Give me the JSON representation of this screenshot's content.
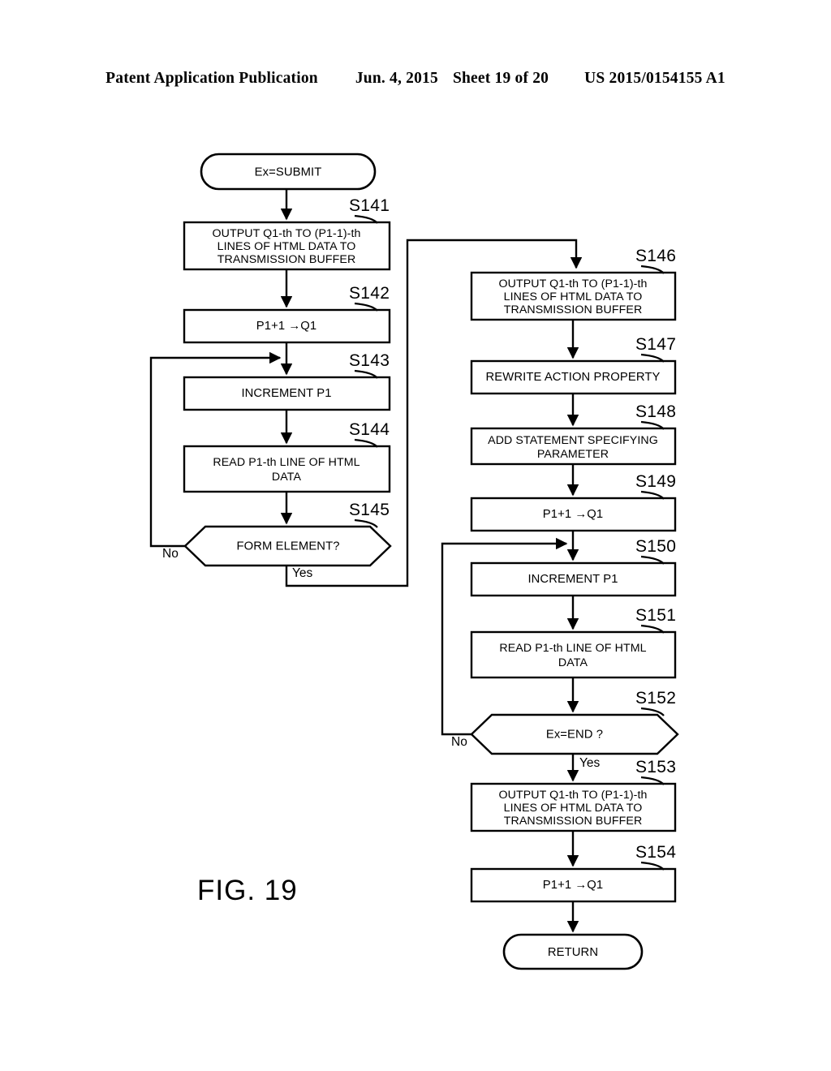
{
  "header": {
    "publication": "Patent Application Publication",
    "date": "Jun. 4, 2015",
    "sheet": "Sheet 19 of 20",
    "number": "US 2015/0154155 A1"
  },
  "figure": {
    "caption": "FIG. 19"
  },
  "flowchart": {
    "start": {
      "id": "start-terminal",
      "text": "Ex=SUBMIT"
    },
    "end": {
      "id": "return-terminal",
      "text": "RETURN"
    },
    "steps": [
      {
        "id": "S141",
        "label": "S141",
        "shape": "process",
        "lines": [
          "OUTPUT Q1-th TO (P1-1)-th",
          "LINES OF HTML DATA TO",
          "TRANSMISSION BUFFER"
        ]
      },
      {
        "id": "S142",
        "label": "S142",
        "shape": "process",
        "lines": [
          "P1+1 →Q1"
        ]
      },
      {
        "id": "S143",
        "label": "S143",
        "shape": "process",
        "lines": [
          "INCREMENT P1"
        ]
      },
      {
        "id": "S144",
        "label": "S144",
        "shape": "process",
        "lines": [
          "READ P1-th LINE OF HTML",
          "DATA"
        ]
      },
      {
        "id": "S145",
        "label": "S145",
        "shape": "decision",
        "lines": [
          "FORM ELEMENT?"
        ],
        "branch_no": "No",
        "branch_yes": "Yes"
      },
      {
        "id": "S146",
        "label": "S146",
        "shape": "process",
        "lines": [
          "OUTPUT Q1-th TO (P1-1)-th",
          "LINES OF HTML DATA TO",
          "TRANSMISSION BUFFER"
        ]
      },
      {
        "id": "S147",
        "label": "S147",
        "shape": "process",
        "lines": [
          "REWRITE ACTION PROPERTY"
        ]
      },
      {
        "id": "S148",
        "label": "S148",
        "shape": "process",
        "lines": [
          "ADD STATEMENT SPECIFYING",
          "PARAMETER"
        ]
      },
      {
        "id": "S149",
        "label": "S149",
        "shape": "process",
        "lines": [
          "P1+1 →Q1"
        ]
      },
      {
        "id": "S150",
        "label": "S150",
        "shape": "process",
        "lines": [
          "INCREMENT P1"
        ]
      },
      {
        "id": "S151",
        "label": "S151",
        "shape": "process",
        "lines": [
          "READ P1-th LINE OF HTML",
          "DATA"
        ]
      },
      {
        "id": "S152",
        "label": "S152",
        "shape": "decision",
        "lines": [
          "Ex=END ?"
        ],
        "branch_no": "No",
        "branch_yes": "Yes"
      },
      {
        "id": "S153",
        "label": "S153",
        "shape": "process",
        "lines": [
          "OUTPUT Q1-th TO (P1-1)-th",
          "LINES OF HTML DATA TO",
          "TRANSMISSION BUFFER"
        ]
      },
      {
        "id": "S154",
        "label": "S154",
        "shape": "process",
        "lines": [
          "P1+1 →Q1"
        ]
      }
    ]
  },
  "colors": {
    "ink": "#000000",
    "paper": "#ffffff"
  }
}
